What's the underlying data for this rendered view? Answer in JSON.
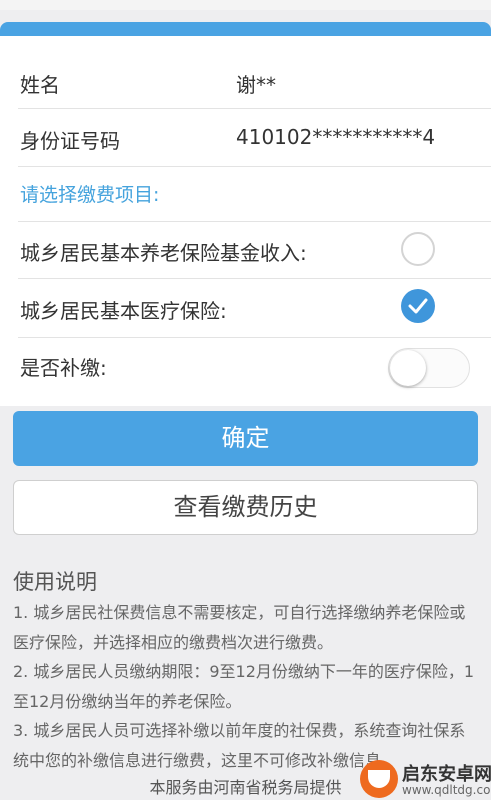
{
  "form": {
    "name_label": "姓名",
    "name_value": "谢**",
    "id_label": "身份证号码",
    "id_value": "410102***********4",
    "section_title": "请选择缴费项目:"
  },
  "options": {
    "pension_label": "城乡居民基本养老保险基金收入:",
    "pension_checked": false,
    "medical_label": "城乡居民基本医疗保险:",
    "medical_checked": true,
    "makeup_label": "是否补缴:",
    "makeup_on": false
  },
  "buttons": {
    "confirm": "确定",
    "history": "查看缴费历史"
  },
  "usage": {
    "title": "使用说明",
    "items": [
      "1. 城乡居民社保费信息不需要核定，可自行选择缴纳养老保险或医疗保险，并选择相应的缴费档次进行缴费。",
      "2. 城乡居民人员缴纳期限：9至12月份缴纳下一年的医疗保险，1至12月份缴纳当年的养老保险。",
      "3. 城乡居民人员可选择补缴以前年度的社保费，系统查询社保系统中您的补缴信息进行缴费，这里不可修改补缴信息。"
    ]
  },
  "footer": {
    "text": "本服务由河南省税务局提供"
  },
  "watermark": {
    "title": "启东安卓网",
    "url": "www.qdltdg.com"
  },
  "colors": {
    "accent": "#4aa3e3",
    "check": "#3f96db",
    "section_title": "#45a3dd"
  }
}
